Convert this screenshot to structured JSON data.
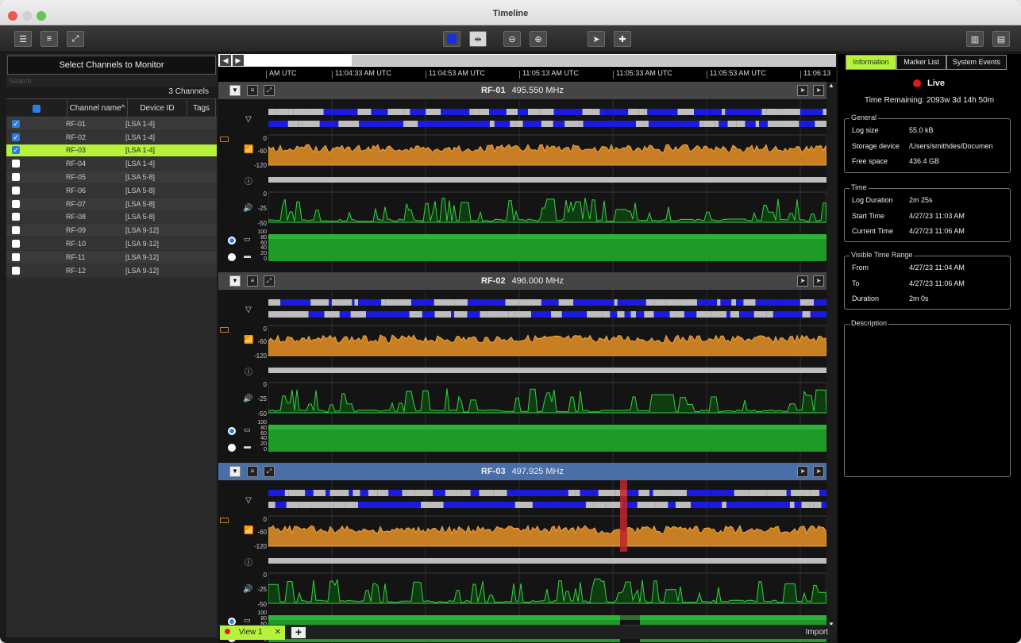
{
  "window": {
    "title": "Timeline"
  },
  "left_panel": {
    "header": "Select Channels to Monitor",
    "search_placeholder": "Search",
    "channel_count": "3  Channels",
    "columns": {
      "name": "Channel name^",
      "device": "Device ID",
      "tags": "Tags"
    },
    "rows": [
      {
        "name": "RF-01",
        "device": "[LSA 1-4]",
        "checked": true
      },
      {
        "name": "RF-02",
        "device": "[LSA 1-4]",
        "checked": true
      },
      {
        "name": "RF-03",
        "device": "[LSA 1-4]",
        "checked": true
      },
      {
        "name": "RF-04",
        "device": "[LSA 1-4]",
        "checked": false
      },
      {
        "name": "RF-05",
        "device": "[LSA 5-8]",
        "checked": false
      },
      {
        "name": "RF-06",
        "device": "[LSA 5-8]",
        "checked": false
      },
      {
        "name": "RF-07",
        "device": "[LSA 5-8]",
        "checked": false
      },
      {
        "name": "RF-08",
        "device": "[LSA 5-8]",
        "checked": false
      },
      {
        "name": "RF-09",
        "device": "[LSA 9-12]",
        "checked": false
      },
      {
        "name": "RF-10",
        "device": "[LSA 9-12]",
        "checked": false
      },
      {
        "name": "RF-11",
        "device": "[LSA 9-12]",
        "checked": false
      },
      {
        "name": "RF-12",
        "device": "[LSA 9-12]",
        "checked": false
      }
    ]
  },
  "time_axis": [
    "AM UTC",
    "11:04:33 AM UTC",
    "11:04:53 AM UTC",
    "11:05:13 AM UTC",
    "11:05:33 AM UTC",
    "11:05:53 AM UTC",
    "11:06:13"
  ],
  "channels": [
    {
      "id": "RF-01",
      "freq": "495.550 MHz",
      "selected": false
    },
    {
      "id": "RF-02",
      "freq": "496.000 MHz",
      "selected": false
    },
    {
      "id": "RF-03",
      "freq": "497.925 MHz",
      "selected": true
    }
  ],
  "y_labels": {
    "rf": [
      "0",
      "-60",
      "-120"
    ],
    "audio": [
      "0",
      "-25",
      "-50"
    ],
    "battery": [
      "100",
      "80",
      "60",
      "40",
      "20",
      "0"
    ]
  },
  "bottom": {
    "tab": "View 1",
    "import": "Import"
  },
  "right_panel": {
    "tabs": [
      "Information",
      "Marker List",
      "System Events"
    ],
    "status": "Live",
    "time_remaining": "Time Remaining: 2093w 3d 14h 50m",
    "general": {
      "title": "General",
      "items": [
        {
          "k": "Log size",
          "v": "55.0 kB"
        },
        {
          "k": "Storage device",
          "v": "/Users/smithdes/Documen"
        },
        {
          "k": "Free space",
          "v": "436.4 GB"
        }
      ]
    },
    "time": {
      "title": "Time",
      "items": [
        {
          "k": "Log Duration",
          "v": "2m 25s"
        },
        {
          "k": "Start Time",
          "v": "4/27/23 11:03 AM"
        },
        {
          "k": "Current Time",
          "v": "4/27/23 11:06 AM"
        }
      ]
    },
    "visible": {
      "title": "Visible Time Range",
      "items": [
        {
          "k": "From",
          "v": "4/27/23 11:04 AM"
        },
        {
          "k": "To",
          "v": "4/27/23 11:06 AM"
        },
        {
          "k": "Duration",
          "v": "2m 0s"
        }
      ]
    },
    "description_title": "Description"
  },
  "colors": {
    "accent": "#b6f23a",
    "rf": "#d4892a",
    "audio": "#2ec23a",
    "battery": "#1e9a2a",
    "carrier": "#1a1ae0",
    "live": "#e01818"
  }
}
